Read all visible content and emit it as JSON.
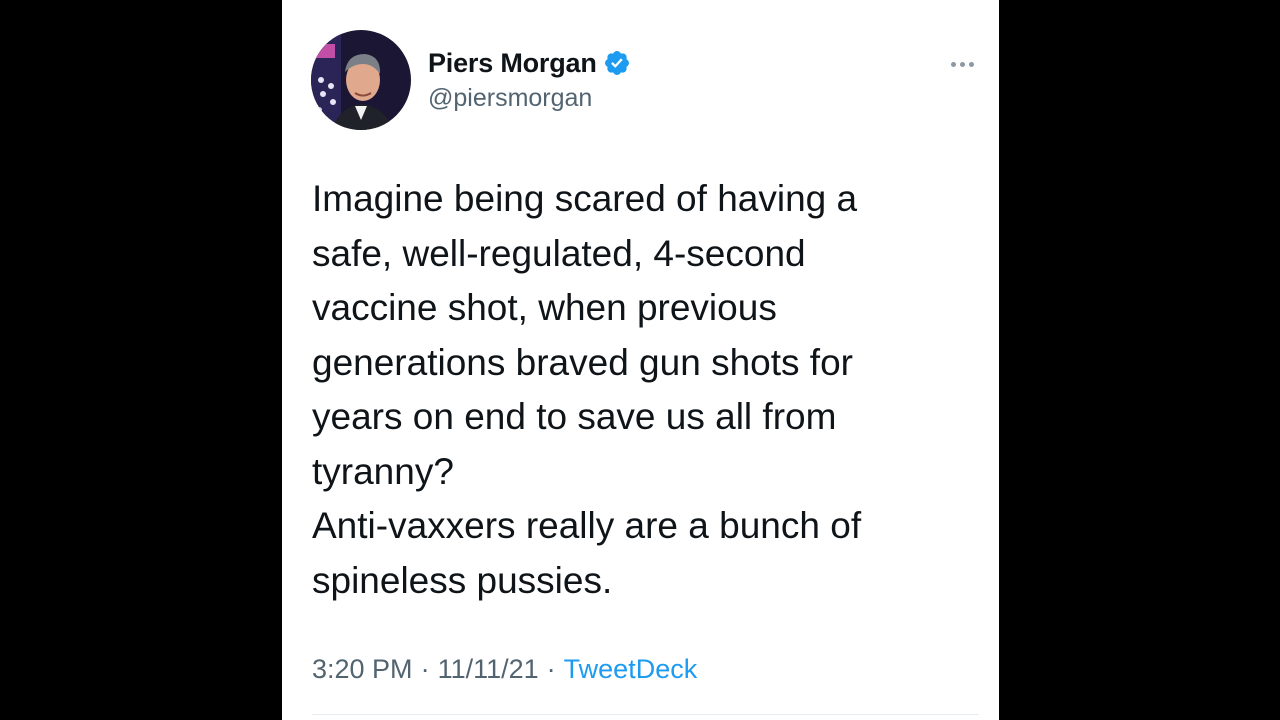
{
  "tweet": {
    "author": {
      "display_name": "Piers Morgan",
      "handle": "@piersmorgan",
      "verified": true,
      "avatar_icon": "avatar-photo"
    },
    "menu_icon": "more-options-icon",
    "text": "Imagine being scared of having a\nsafe, well-regulated, 4-second\nvaccine shot, when previous\ngenerations braved gun shots for\nyears on end to save us all from\ntyranny?\nAnti-vaxxers really are a bunch of\nspineless pussies.",
    "time": "3:20 PM",
    "date": "11/11/21",
    "separator": "·",
    "source": "TweetDeck"
  },
  "colors": {
    "background": "#000000",
    "card": "#ffffff",
    "text": "#0f1419",
    "secondary": "#536471",
    "link": "#1d9bf0",
    "verified": "#1d9bf0"
  }
}
